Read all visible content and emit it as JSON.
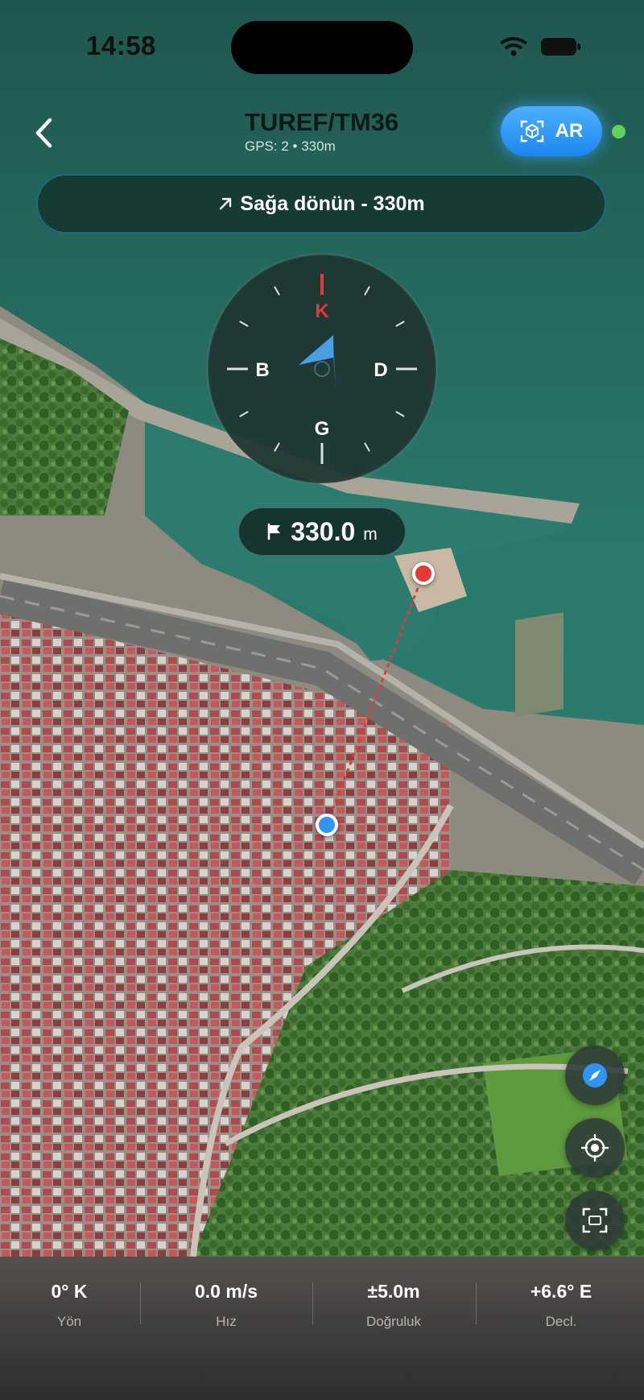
{
  "status_bar": {
    "time": "14:58"
  },
  "header": {
    "title": "TUREF/TM36",
    "subtitle": "GPS: 2 • 330m",
    "ar_label": "AR"
  },
  "navigation": {
    "instruction": "Sağa dönün - 330m"
  },
  "compass": {
    "north": "K",
    "south": "G",
    "east": "D",
    "west": "B",
    "heading_deg": 0
  },
  "distance": {
    "value": "330.0",
    "unit": "m"
  },
  "stats": [
    {
      "value": "0° K",
      "label": "Yön"
    },
    {
      "value": "0.0 m/s",
      "label": "Hız"
    },
    {
      "value": "±5.0m",
      "label": "Doğruluk"
    },
    {
      "value": "+6.6° E",
      "label": "Decl."
    }
  ],
  "colors": {
    "accent_blue": "#2f95f5",
    "target_red": "#e53935",
    "status_green": "#5fd05a",
    "north_red": "#e53935"
  },
  "icons": [
    "back-chevron-icon",
    "ar-cube-icon",
    "arrow-up-right-icon",
    "flag-icon",
    "compass-icon",
    "locate-icon",
    "scan-frame-icon",
    "wifi-icon",
    "battery-icon"
  ]
}
